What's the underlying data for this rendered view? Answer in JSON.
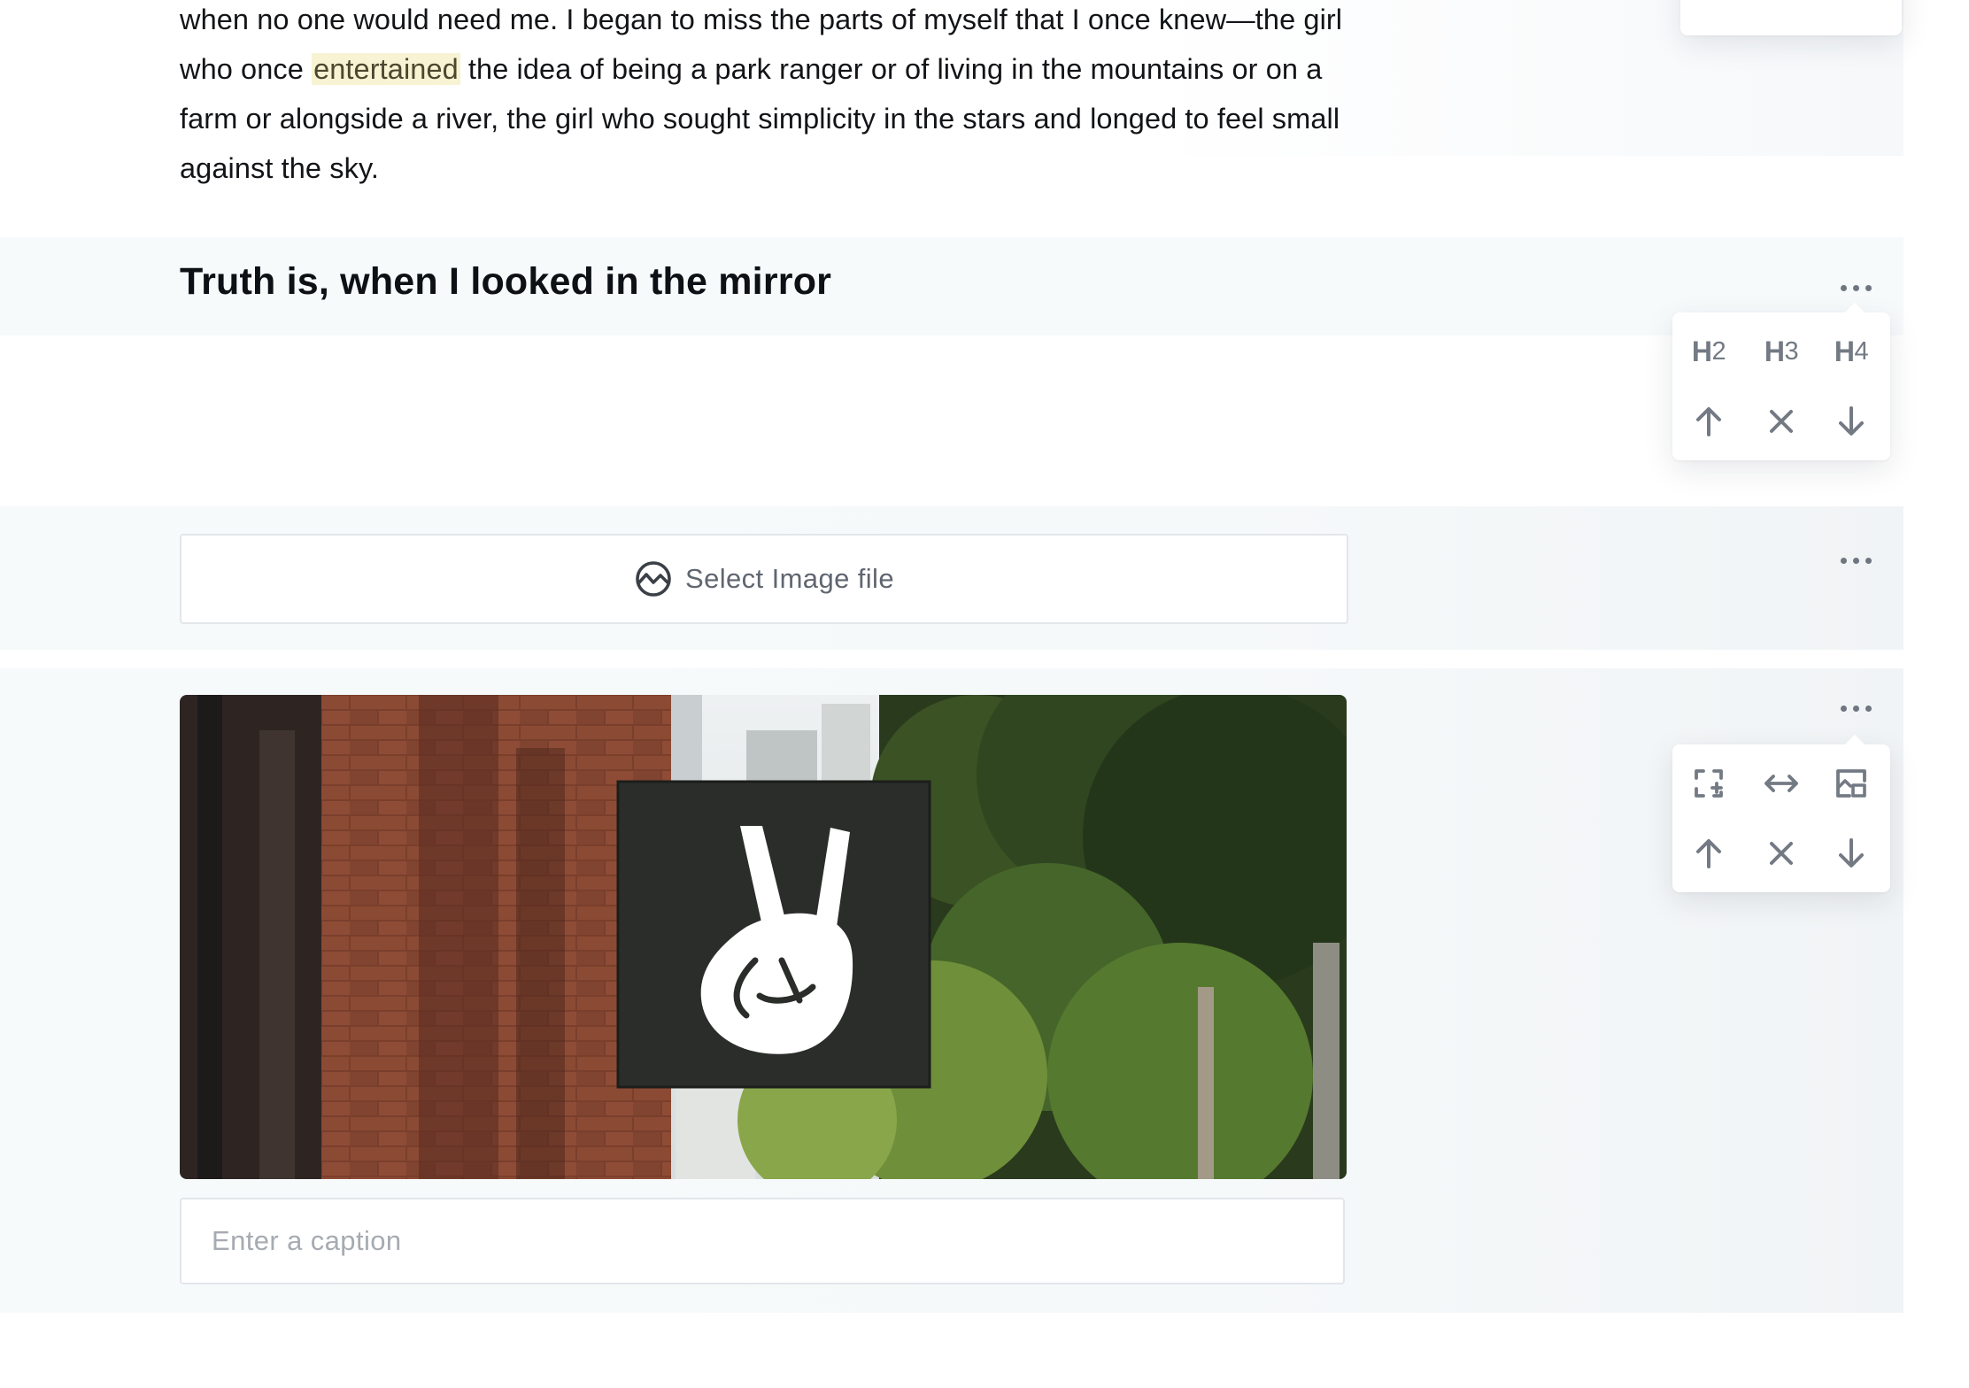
{
  "paragraph": {
    "text_before": "when no one would need me. I began to miss the parts of myself that I once knew—the girl who once ",
    "highlight": "entertained",
    "text_after": " the idea of being a park ranger or of living in the mountains or on a farm or alongside a river, the girl who sought simplicity in the stars and longed to feel small against the sky."
  },
  "heading": {
    "text": "Truth is, when I looked in the mirror",
    "menu": {
      "h2_label": "H",
      "h2_num": "2",
      "h3_label": "H",
      "h3_num": "3",
      "h4_label": "H",
      "h4_num": "4"
    }
  },
  "upload": {
    "label": "Select Image file"
  },
  "image": {
    "alt": "Peace hand sign on building",
    "caption_placeholder": "Enter a caption",
    "caption_value": ""
  },
  "icons": {
    "more": "more-dots-icon",
    "up": "arrow-up-icon",
    "remove": "close-icon",
    "down": "arrow-down-icon",
    "upload": "image-icon",
    "full_width": "expand-width-icon",
    "wide": "horizontal-arrows-icon",
    "wrap": "image-wrap-icon"
  },
  "colors": {
    "icon_gray": "#737a84",
    "highlight_bg": "#f8f3d2",
    "block_bg": "#f6fafb"
  }
}
